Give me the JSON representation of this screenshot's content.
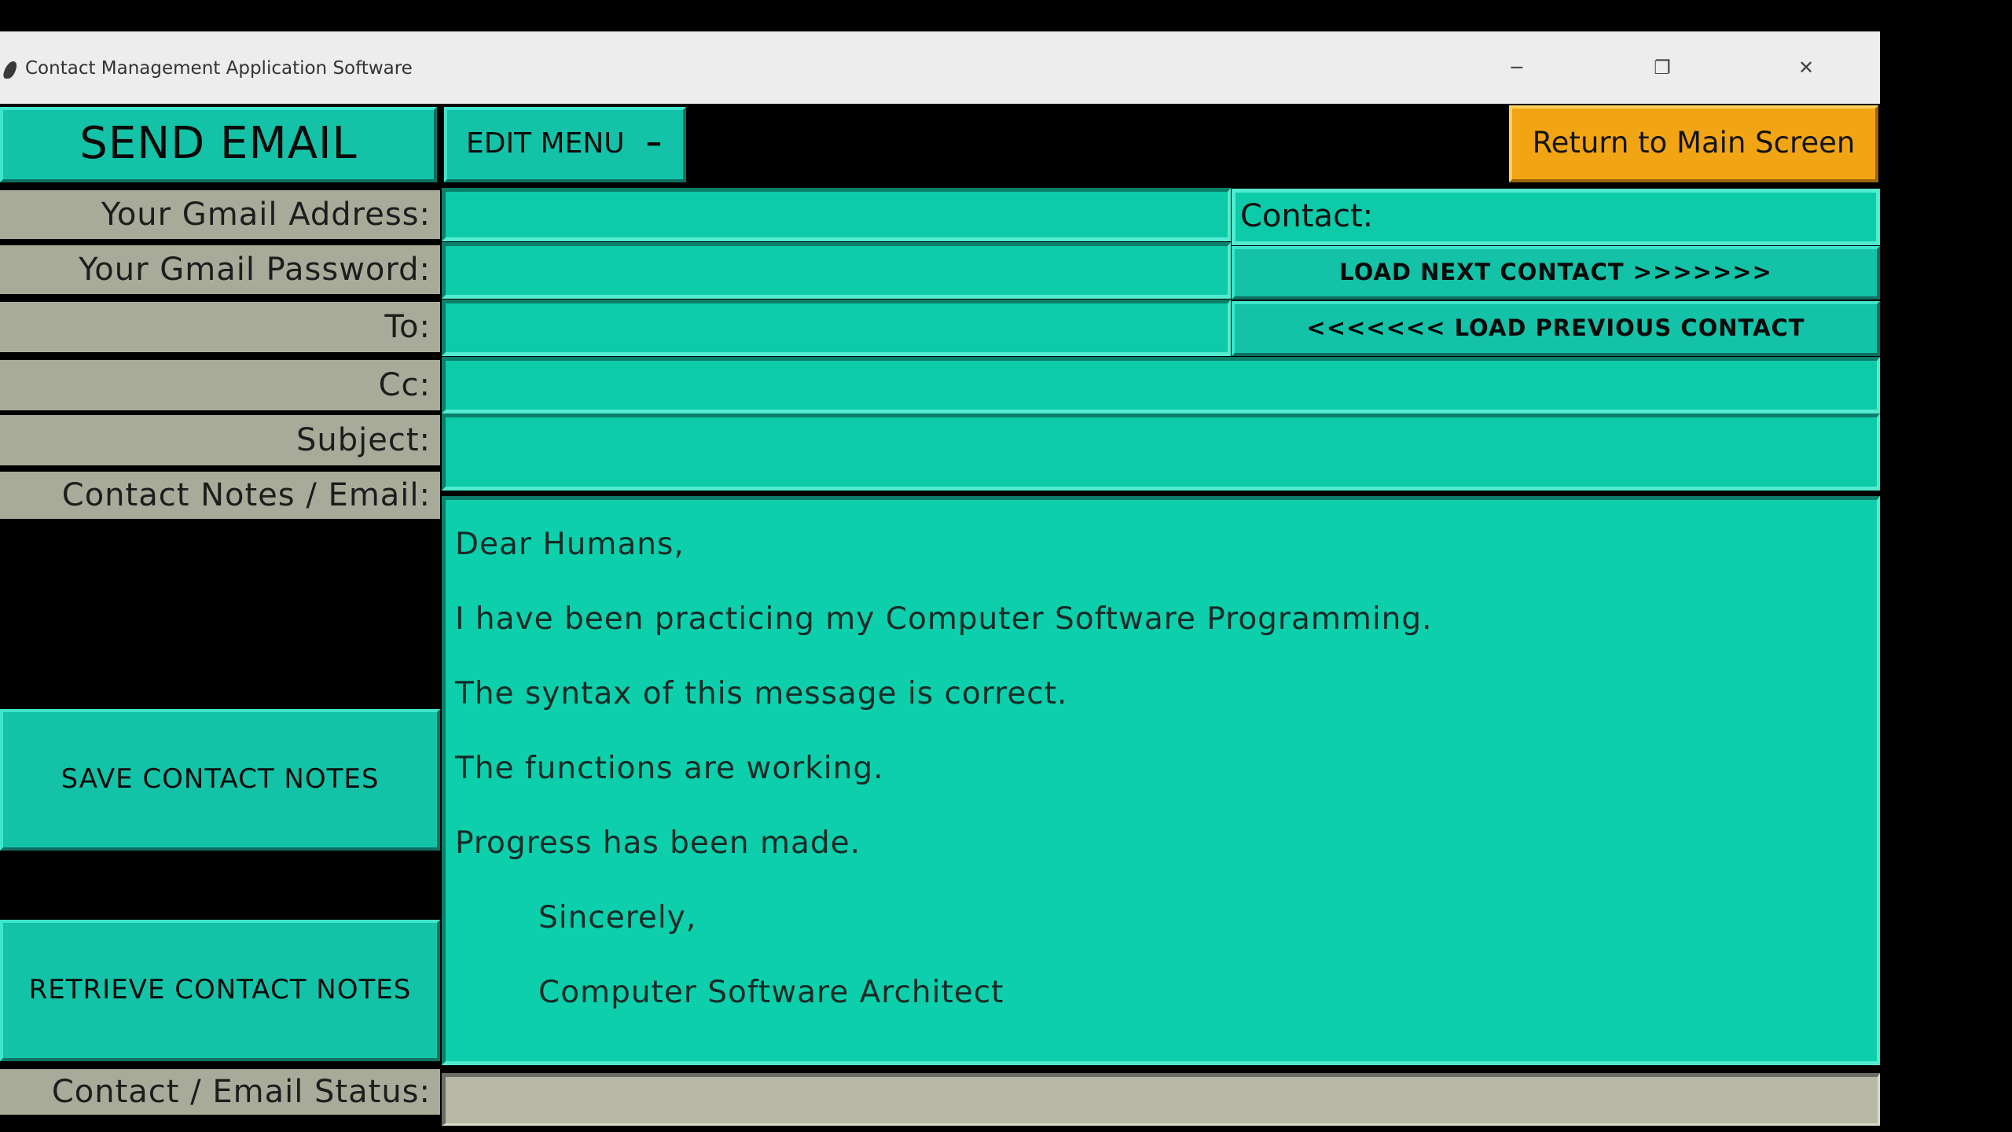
{
  "window": {
    "title": "Contact Management Application Software",
    "min_glyph": "─",
    "max_glyph": "❐",
    "close_glyph": "✕"
  },
  "toolbar": {
    "send_email": "SEND EMAIL",
    "edit_menu": "EDIT MENU",
    "edit_menu_indicator": "━",
    "return_main": "Return to Main Screen"
  },
  "form": {
    "gmail_address_label": "Your Gmail Address:",
    "gmail_address_value": "",
    "gmail_password_label": "Your Gmail Password:",
    "gmail_password_value": "",
    "to_label": "To:",
    "to_value": "",
    "cc_label": "Cc:",
    "cc_value": "",
    "subject_label": "Subject:",
    "subject_value": "",
    "notes_label": "Contact Notes / Email:",
    "status_label": "Contact / Email Status:",
    "status_value": ""
  },
  "contact": {
    "label": "Contact:",
    "load_next": "LOAD NEXT CONTACT >>>>>>>",
    "load_previous": "<<<<<<<  LOAD PREVIOUS CONTACT"
  },
  "side_buttons": {
    "save_notes": "SAVE CONTACT NOTES",
    "retrieve_notes": "RETRIEVE CONTACT NOTES"
  },
  "notes": {
    "lines": [
      "Dear Humans,",
      "I have been practicing my Computer Software Programming.",
      "The syntax of this message is correct.",
      "The functions are working.",
      "Progress has been made.",
      "Sincerely,",
      "Computer Software Architect"
    ]
  },
  "colors": {
    "teal_button": "#14c2a7",
    "teal_entry": "#0dcba9",
    "orange_button": "#f2a514",
    "label_gray": "#a9ab9a",
    "background": "#000000"
  }
}
